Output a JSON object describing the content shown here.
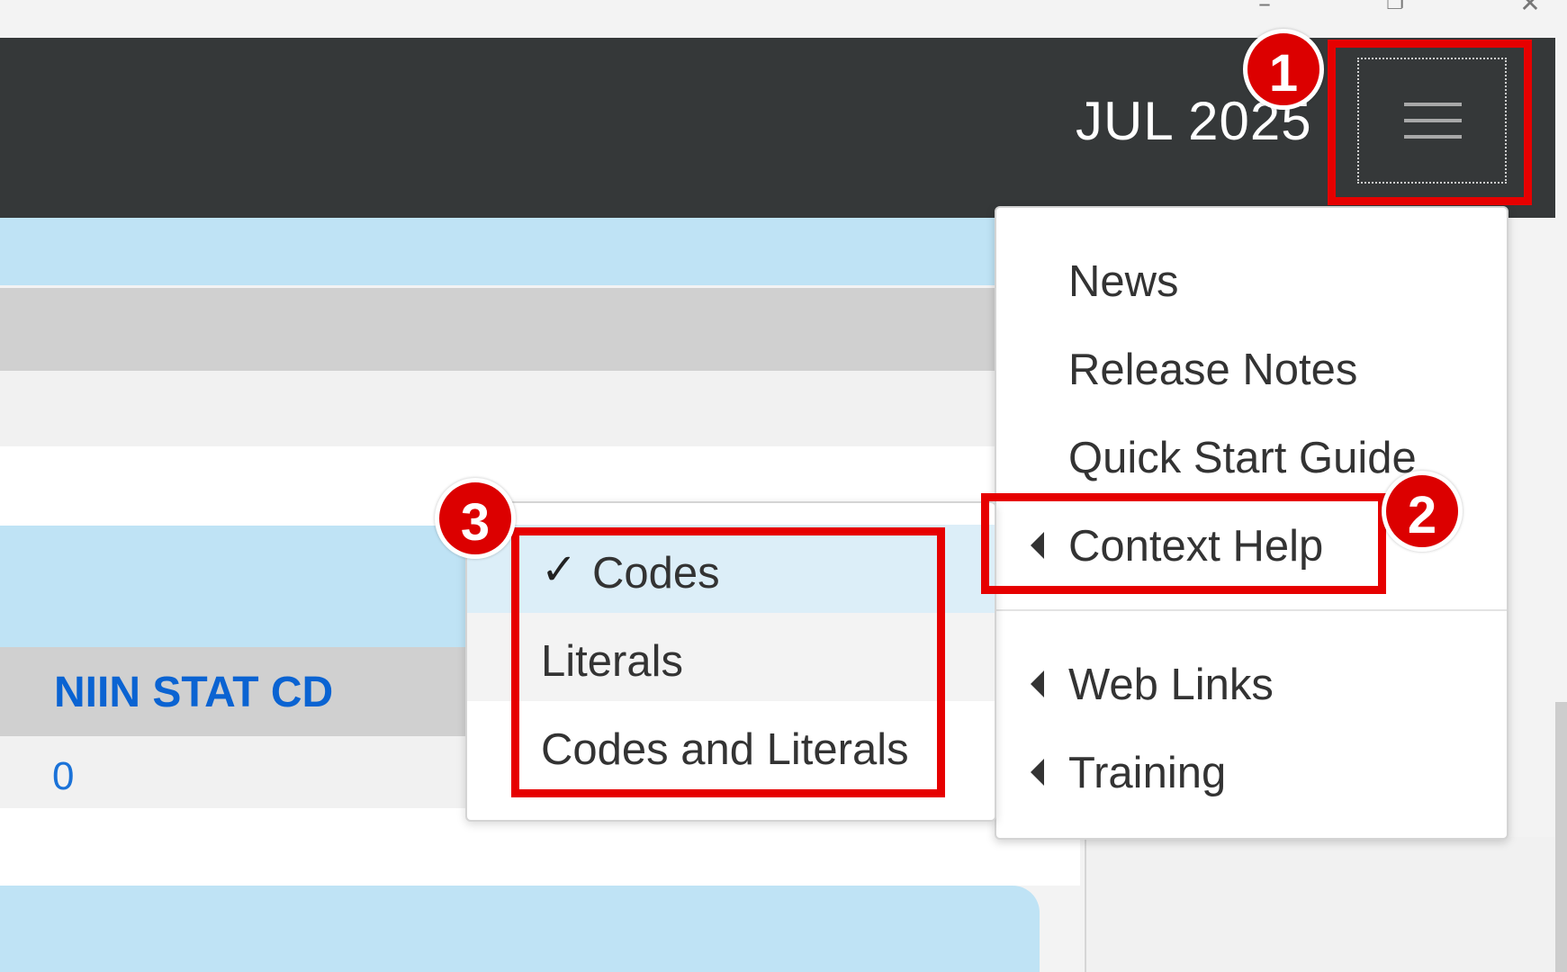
{
  "header": {
    "month_label": "JUL 2025",
    "menu_button_icon": "hamburger-menu-icon"
  },
  "window_controls": [
    "minimize-icon",
    "restore-icon",
    "close-icon"
  ],
  "table": {
    "column_header": "NIIN STAT CD",
    "cell_value": "0"
  },
  "menu": {
    "items": [
      {
        "label": "News",
        "has_submenu": false
      },
      {
        "label": "Release Notes",
        "has_submenu": false
      },
      {
        "label": "Quick Start Guide",
        "has_submenu": false
      },
      {
        "label": "Context Help",
        "has_submenu": true
      },
      {
        "label": "Web Links",
        "has_submenu": true
      },
      {
        "label": "Training",
        "has_submenu": true
      }
    ]
  },
  "submenu": {
    "items": [
      {
        "label": "Codes",
        "checked": true
      },
      {
        "label": "Literals",
        "checked": false
      },
      {
        "label": "Codes and Literals",
        "checked": false
      }
    ],
    "check_glyph": "✓"
  },
  "annotations": {
    "badges": [
      "1",
      "2",
      "3"
    ],
    "color": "#e60000"
  },
  "colors": {
    "header_bg": "#353839",
    "highlight_blue": "#bfe3f5",
    "link_blue": "#0a63d2"
  }
}
